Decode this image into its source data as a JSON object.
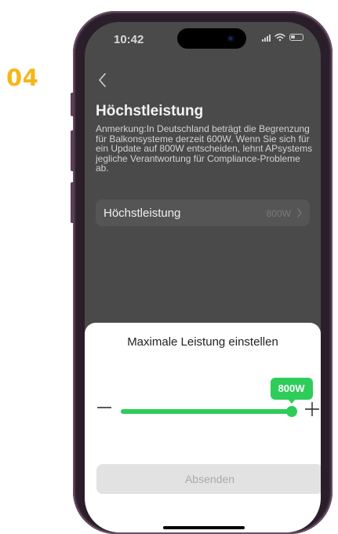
{
  "step": {
    "number": "04"
  },
  "status_bar": {
    "time": "10:42"
  },
  "page": {
    "title": "Höchstleistung",
    "note": "Anmerkung:In Deutschland beträgt die Begrenzung für Balkonsysteme derzeit 600W. Wenn Sie sich für ein Update auf 800W entscheiden, lehnt APsystems jegliche Verantwortung für Compliance-Probleme ab."
  },
  "setting_row": {
    "label": "Höchstleistung",
    "value": "800W"
  },
  "sheet": {
    "title": "Maximale Leistung einstellen",
    "slider": {
      "value_label": "800W",
      "fill_fraction": 0.98
    },
    "submit_label": "Absenden"
  },
  "colors": {
    "accent": "#2ECC59",
    "step_number": "#F5B61A",
    "dimmed_background": "#4A4A4A",
    "disabled_button": "#E2E2E2"
  },
  "icons": [
    "back-chevron-icon",
    "chevron-right-icon",
    "minus-icon",
    "plus-icon",
    "signal-icon",
    "wifi-icon",
    "battery-icon"
  ]
}
